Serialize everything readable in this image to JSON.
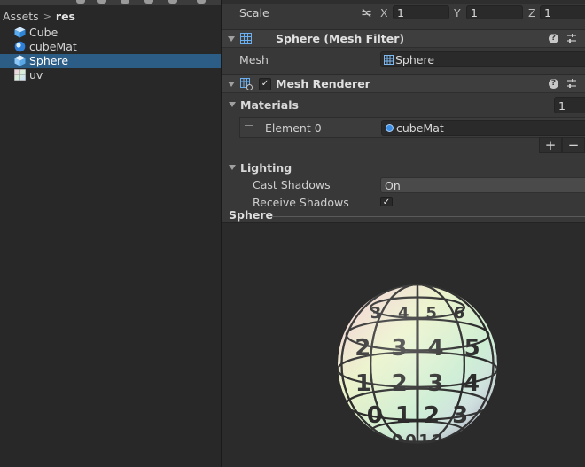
{
  "project": {
    "breadcrumb": {
      "root": "Assets",
      "current": "res"
    },
    "assets": [
      {
        "name": "Cube",
        "icon": "cube-icon",
        "selected": false
      },
      {
        "name": "cubeMat",
        "icon": "material-icon",
        "selected": false
      },
      {
        "name": "Sphere",
        "icon": "cube-icon",
        "selected": true
      },
      {
        "name": "uv",
        "icon": "texture-icon",
        "selected": false
      }
    ]
  },
  "inspector": {
    "transform": {
      "scale_label": "Scale",
      "x_label": "X",
      "x": "1",
      "y_label": "Y",
      "y": "1",
      "z_label": "Z",
      "z": "1"
    },
    "mesh_filter": {
      "title": "Sphere (Mesh Filter)",
      "mesh_label": "Mesh",
      "mesh_value": "Sphere"
    },
    "mesh_renderer": {
      "title": "Mesh Renderer",
      "enabled": true,
      "materials_label": "Materials",
      "materials_count": "1",
      "element_label": "Element 0",
      "element_value": "cubeMat",
      "add_label": "+",
      "remove_label": "−",
      "lighting_label": "Lighting",
      "cast_shadows_label": "Cast Shadows",
      "cast_shadows_value": "On",
      "receive_shadows_label": "Receive Shadows",
      "receive_shadows_checked": true
    }
  },
  "preview": {
    "title": "Sphere",
    "sphere_numbers": [
      "3",
      "4",
      "5",
      "6",
      "2",
      "3",
      "4",
      "5",
      "1",
      "2",
      "3",
      "4",
      "0",
      "1",
      "2",
      "3",
      "9",
      "0",
      "1",
      "2"
    ]
  },
  "colors": {
    "panel_bg": "#282828",
    "inspector_bg": "#383838",
    "selection": "#2c5d87",
    "preview_bg": "#2b2b2b"
  }
}
